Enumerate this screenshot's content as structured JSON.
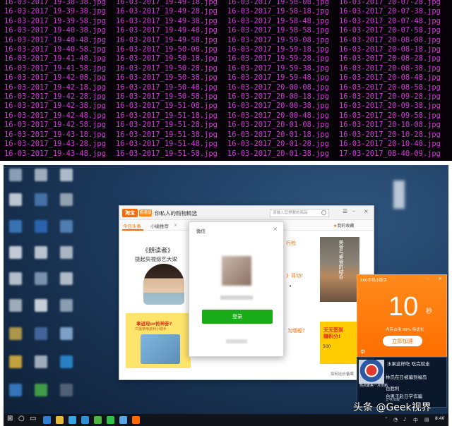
{
  "terminal": {
    "filenames": [
      [
        "16-03-2017_19-38-38.jpg",
        "16-03-2017_19-49-18.jpg",
        "16-03-2017_19-58-08.jpg",
        "16-03-2017_20-07-28.jpg"
      ],
      [
        "16-03-2017_19-39-38.jpg",
        "16-03-2017_19-49-28.jpg",
        "16-03-2017_19-58-18.jpg",
        "16-03-2017_20-07-38.jpg"
      ],
      [
        "16-03-2017_19-39-58.jpg",
        "16-03-2017_19-49-38.jpg",
        "16-03-2017_19-58-48.jpg",
        "16-03-2017_20-07-48.jpg"
      ],
      [
        "16-03-2017_19-40-38.jpg",
        "16-03-2017_19-49-48.jpg",
        "16-03-2017_19-58-58.jpg",
        "16-03-2017_20-07-58.jpg"
      ],
      [
        "16-03-2017_19-40-48.jpg",
        "16-03-2017_19-49-58.jpg",
        "16-03-2017_19-59-08.jpg",
        "16-03-2017_20-08-08.jpg"
      ],
      [
        "16-03-2017_19-40-58.jpg",
        "16-03-2017_19-50-08.jpg",
        "16-03-2017_19-59-18.jpg",
        "16-03-2017_20-08-18.jpg"
      ],
      [
        "16-03-2017_19-41-48.jpg",
        "16-03-2017_19-50-18.jpg",
        "16-03-2017_19-59-28.jpg",
        "16-03-2017_20-08-28.jpg"
      ],
      [
        "16-03-2017_19-41-58.jpg",
        "16-03-2017_19-50-28.jpg",
        "16-03-2017_19-59-38.jpg",
        "16-03-2017_20-08-38.jpg"
      ],
      [
        "16-03-2017_19-42-08.jpg",
        "16-03-2017_19-50-38.jpg",
        "16-03-2017_19-59-48.jpg",
        "16-03-2017_20-08-48.jpg"
      ],
      [
        "16-03-2017_19-42-18.jpg",
        "16-03-2017_19-50-48.jpg",
        "16-03-2017_20-00-08.jpg",
        "16-03-2017_20-08-58.jpg"
      ],
      [
        "16-03-2017_19-42-28.jpg",
        "16-03-2017_19-50-58.jpg",
        "16-03-2017_20-00-18.jpg",
        "16-03-2017_20-09-28.jpg"
      ],
      [
        "16-03-2017_19-42-38.jpg",
        "16-03-2017_19-51-08.jpg",
        "16-03-2017_20-00-38.jpg",
        "16-03-2017_20-09-38.jpg"
      ],
      [
        "16-03-2017_19-42-48.jpg",
        "16-03-2017_19-51-18.jpg",
        "16-03-2017_20-00-48.jpg",
        "16-03-2017_20-09-58.jpg"
      ],
      [
        "16-03-2017_19-42-58.jpg",
        "16-03-2017_19-51-28.jpg",
        "16-03-2017_20-01-08.jpg",
        "16-03-2017_20-10-08.jpg"
      ],
      [
        "16-03-2017_19-43-18.jpg",
        "16-03-2017_19-51-38.jpg",
        "16-03-2017_20-01-18.jpg",
        "16-03-2017_20-10-28.jpg"
      ],
      [
        "16-03-2017_19-43-28.jpg",
        "16-03-2017_19-51-48.jpg",
        "16-03-2017_20-01-28.jpg",
        "16-03-2017_20-10-48.jpg"
      ],
      [
        "16-03-2017_19-43-48.jpg",
        "16-03-2017_19-51-58.jpg",
        "16-03-2017_20-01-38.jpg",
        "17-03-2017_08-40-09.jpg"
      ]
    ],
    "text_color": "#d23ad8"
  },
  "browser": {
    "logo": "淘宝",
    "badge": "极速版",
    "title": "你私人的购物精选",
    "search_placeholder": "请输入您想要的商品",
    "tabs": [
      "今日头条",
      "小编推荐"
    ],
    "right_tab": "我的收藏",
    "ad_title": "《朗读者》",
    "ad_subtitle": "挑起央视综艺大梁",
    "banner_line1": "拿返现or抢神券?",
    "banner_line2": "只需使用返利小助手",
    "mid_texts": [
      "行检",
      "》背功!",
      "为哪般?"
    ],
    "food_text": "美食与美食的结合",
    "promo_line1": "天天签到",
    "promo_line2": "赚积分!",
    "promo_sub": "500",
    "footer": "如何比价备案",
    "accent": "#ff6a00"
  },
  "dialog": {
    "title": "微信",
    "login_label": "登录",
    "accent": "#1aad19"
  },
  "widget": {
    "title": "360手机小助手",
    "countdown": "10",
    "unit": "秒",
    "memory_text": "内存占用 99% 待优化",
    "button_label": "立即加速",
    "accent": "#ff6e00"
  },
  "news": {
    "items": [
      "水果这样吃 吃完就走",
      "林氏在日被骗到福岛 ",
      "台男子赴日学诈骗 ",
      "台胜利 "
    ],
    "caption": "热点聚焦一月份新",
    "subtext": "正在加载"
  },
  "taskbar": {
    "time": "8:40"
  },
  "watermark": "头条 @Geek视界"
}
